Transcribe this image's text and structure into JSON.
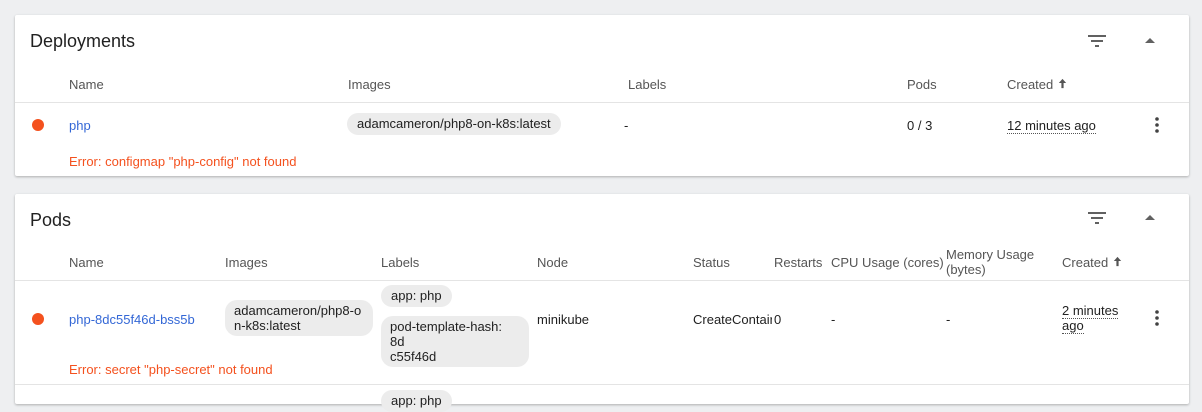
{
  "deployments": {
    "title": "Deployments",
    "headers": {
      "name": "Name",
      "images": "Images",
      "labels": "Labels",
      "pods": "Pods",
      "created": "Created"
    },
    "sort_icon": "arrow-up-icon",
    "row": {
      "status_color": "#f4511e",
      "name": "php",
      "image": "adamcameron/php8-on-k8s:latest",
      "labels": "-",
      "pods": "0 / 3",
      "created": "12 minutes ago",
      "error": "Error: configmap \"php-config\" not found"
    }
  },
  "pods": {
    "title": "Pods",
    "headers": {
      "name": "Name",
      "images": "Images",
      "labels": "Labels",
      "node": "Node",
      "status": "Status",
      "restarts": "Restarts",
      "cpu": "CPU Usage (cores)",
      "memory_line1": "Memory Usage",
      "memory_line2": "(bytes)",
      "created": "Created"
    },
    "row": {
      "status_color": "#f4511e",
      "name": "php-8dc55f46d-bss5b",
      "image_line1": "adamcameron/php8-o",
      "image_line2": "n-k8s:latest",
      "label1": "app: php",
      "label2_line1": "pod-template-hash: 8d",
      "label2_line2": "c55f46d",
      "node": "minikube",
      "status": "CreateContair",
      "restarts": "0",
      "cpu": "-",
      "memory": "-",
      "created_line1": "2 minutes",
      "created_line2": "ago",
      "error": "Error: secret \"php-secret\" not found"
    },
    "next_row_label_partial": "app: php"
  },
  "colors": {
    "accent": "#3367d6",
    "error": "#f4511e",
    "background": "#eeeff1"
  }
}
